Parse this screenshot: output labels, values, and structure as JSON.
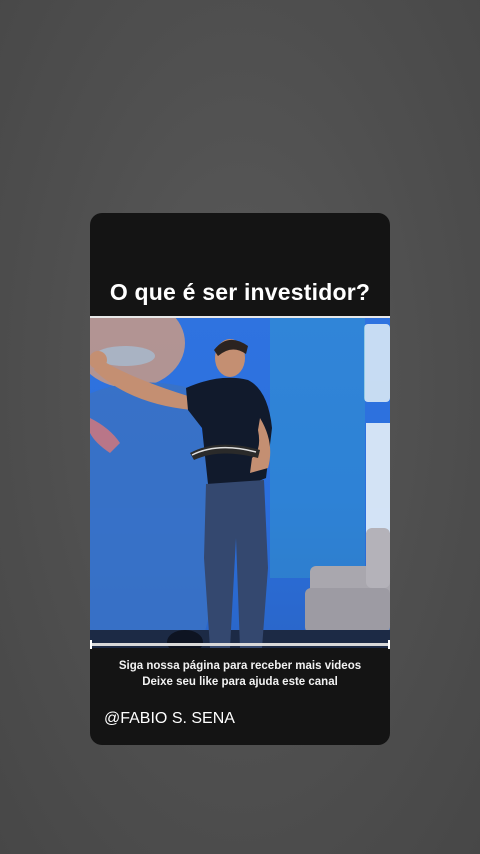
{
  "story": {
    "title": "O que é ser investidor?",
    "caption_line1": "Siga nossa página para receber mais videos",
    "caption_line2": "Deixe seu like para ajuda este canal",
    "handle": "@FABIO S. SENA"
  },
  "colors": {
    "page_background": "#4f4f4f",
    "card_background": "#141414",
    "video_background": "#2f73e0",
    "text": "#ffffff"
  }
}
